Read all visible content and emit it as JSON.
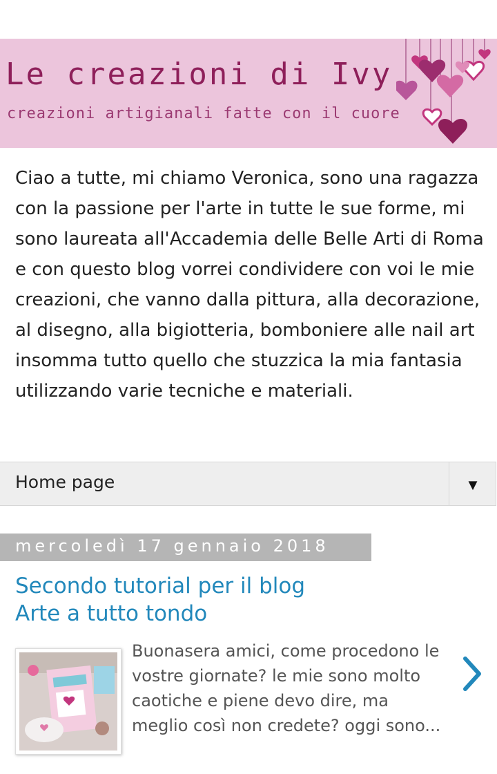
{
  "header": {
    "title": "Le creazioni di Ivy",
    "subtitle": "creazioni artigianali fatte con il cuore"
  },
  "intro": {
    "text": "Ciao a tutte, mi chiamo Veronica, sono una ragazza con la passione per l'arte in tutte le sue forme, mi sono laureata all'Accademia delle Belle Arti di Roma e con questo blog vorrei condividere con voi le mie creazioni, che vanno dalla pittura, alla decorazione, al disegno, alla bigiotteria, bomboniere alle nail art insomma tutto quello che stuzzica la mia fantasia utilizzando varie tecniche e materiali."
  },
  "nav": {
    "selected": "Home page",
    "arrow": "▼"
  },
  "post": {
    "date": "mercoledì 17 gennaio 2018",
    "title_line1": "Secondo tutorial per il blog",
    "title_line2": "Arte a tutto tondo",
    "snippet": " Buonasera amici, come procedono le vostre giornate? le mie sono molto caotiche e piene devo dire, ma meglio così non credete? oggi sono..."
  },
  "colors": {
    "banner_bg": "#ecc5dc",
    "title": "#8e1f5a",
    "link": "#2288bb",
    "date_bg": "#b5b5b5"
  },
  "icons": {
    "nav_arrow": "triangle-down-icon",
    "next": "chevron-right-icon",
    "banner_art": "hanging-hearts-icon"
  }
}
